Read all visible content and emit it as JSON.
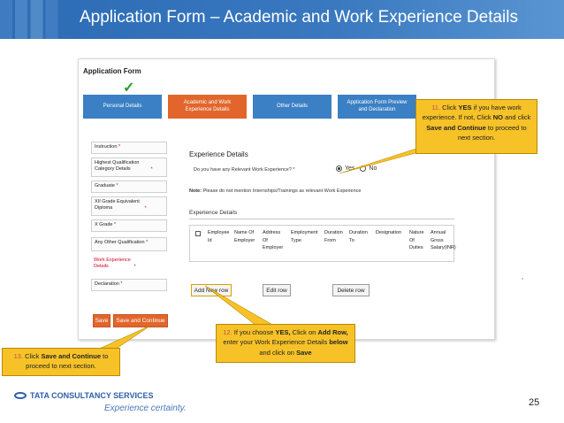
{
  "header": {
    "title": "Application Form – Academic and Work Experience Details"
  },
  "form": {
    "title": "Application Form",
    "check_icon": "✓",
    "tabs": [
      {
        "label": "Personal Details",
        "state": "completed"
      },
      {
        "label": "Academic and Work Experience Details",
        "state": "active"
      },
      {
        "label": "Other Details",
        "state": "pending"
      },
      {
        "label": "Application Form Preview and Declaration",
        "state": "pending"
      }
    ],
    "sidemenu": [
      {
        "label": "Instruction",
        "required": "*"
      },
      {
        "label": "Highest Qualification Category Details",
        "required": "*"
      },
      {
        "label": "Graduate",
        "required": "*"
      },
      {
        "label": "XII Grade Equivalent Diploma",
        "required": "*"
      },
      {
        "label": "X Grade",
        "required": "*"
      },
      {
        "label": "Any Other Qualification",
        "required": "*"
      },
      {
        "label": "Work Experience Details",
        "required": "*"
      },
      {
        "label": "Declaration",
        "required": "*"
      }
    ],
    "save_label": "Save",
    "save_continue_label": "Save and Continue"
  },
  "experience": {
    "title": "Experience Details",
    "question": "Do you have any Relevant Work Experience?",
    "question_required": "*",
    "yes_label": "Yes",
    "no_label": "No",
    "selected": "Yes",
    "note_prefix": "Note:",
    "note_text": "Please do not mention Internships/Trainings as relevant Work Experience",
    "table_title": "Experience Details",
    "columns": [
      "Employee Id",
      "Name Of Employer",
      "Address Of Employer",
      "Employment Type",
      "Duration From",
      "Duration To",
      "Designation",
      "Nature Of Duties",
      "Annual Gross Salary(INR)"
    ],
    "add_row_label": "Add New row",
    "edit_row_label": "Edit row",
    "delete_row_label": "Delete row"
  },
  "callouts": {
    "c11": {
      "num": "11.",
      "pre": "Click",
      "yes": "YES",
      "mid": "if you have work experience. If not, Click",
      "no": "NO",
      "and": "and click",
      "save_continue": "Save and Continue",
      "post": "to proceed to next section."
    },
    "c12": {
      "num": "12.",
      "pre": "If you choose",
      "yes": "YES,",
      "mid": "Click on",
      "add_row": "Add Row,",
      "mid2": "enter your Work Experience Details",
      "below": "below",
      "and": "and click on",
      "save": "Save"
    },
    "c13": {
      "num": "13.",
      "pre": "Click",
      "save_continue": "Save and Continue",
      "post": "to proceed to next section."
    }
  },
  "footer": {
    "brand": "TATA CONSULTANCY SERVICES",
    "tagline": "Experience certainty.",
    "page_number": "25"
  },
  "colors": {
    "header_blue": "#2f6db3",
    "tab_blue": "#3b7fc4",
    "tab_orange": "#e2662c",
    "callout_yellow": "#f6c228",
    "required_red": "#d0021b"
  }
}
